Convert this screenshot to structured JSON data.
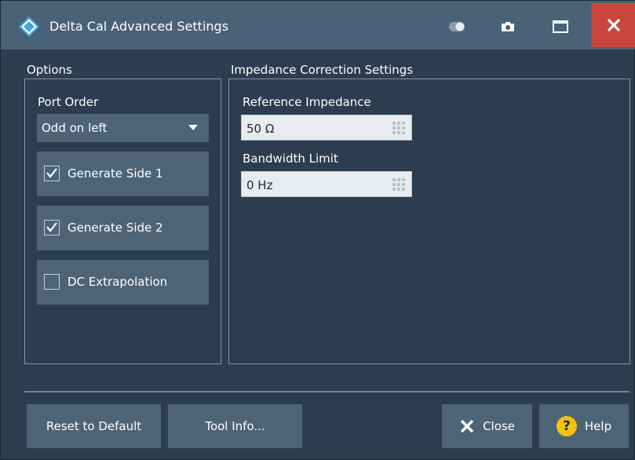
{
  "window": {
    "title": "Delta Cal Advanced Settings",
    "close_color": "#c8463b",
    "titlebar_color": "#4a6278",
    "background_color": "#2b3d4e"
  },
  "titlebar_buttons": {
    "toggle_icon": "toggle-icon",
    "camera_icon": "camera-icon",
    "maximize_icon": "maximize-icon",
    "close_icon": "close-icon"
  },
  "options": {
    "group_title": "Options",
    "port_order_label": "Port Order",
    "port_order_value": "Odd on left",
    "checkboxes": [
      {
        "label": "Generate Side 1",
        "checked": true
      },
      {
        "label": "Generate Side 2",
        "checked": true
      },
      {
        "label": "DC Extrapolation",
        "checked": false
      }
    ]
  },
  "impedance": {
    "group_title": "Impedance Correction Settings",
    "reference_label": "Reference Impedance",
    "reference_value": "50 Ω",
    "bandwidth_label": "Bandwidth Limit",
    "bandwidth_value": "0 Hz"
  },
  "footer": {
    "reset_label": "Reset to Default",
    "toolinfo_label": "Tool Info...",
    "close_label": "Close",
    "help_label": "Help",
    "help_glyph": "?",
    "help_color": "#f2c20c"
  }
}
